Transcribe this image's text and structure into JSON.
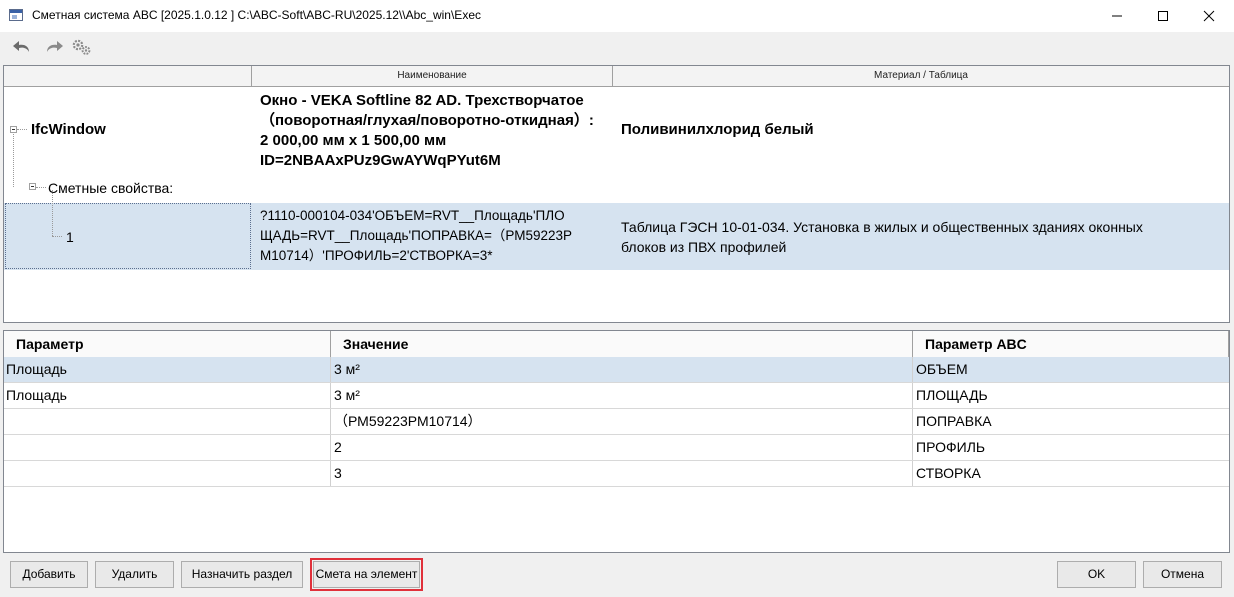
{
  "window": {
    "title": "Сметная система ABC [2025.1.0.12 ]   C:\\ABC-Soft\\ABC-RU\\2025.12\\\\Abc_win\\Exec"
  },
  "toolbar": {
    "undo_icon": "undo-arrow-icon",
    "redo_icon": "redo-arrow-icon",
    "settings_icon": "gears-icon"
  },
  "tree": {
    "columns": {
      "name": "Наименование",
      "material": "Материал / Таблица"
    },
    "root": {
      "label": "IfcWindow",
      "name_lines": [
        "Окно - VEKA Softline 82 AD. Трехстворчатое",
        "（поворотная/глухая/поворотно-откидная）:",
        "2 000,00 мм x 1 500,00 мм",
        "ID=2NBAAxPUz9GwAYWqPYut6M"
      ],
      "material": "Поливинилхлорид белый"
    },
    "group": {
      "label": "Сметные свойства:"
    },
    "item": {
      "label": "1",
      "formula_lines": [
        "?1110-000104-034'ОБЪЕМ=RVT__Площадь'ПЛО",
        "ЩАДЬ=RVT__Площадь'ПОПРАВКА=（РМ59223Р",
        "М10714）'ПРОФИЛЬ=2'СТВОРКА=3*"
      ],
      "table_lines": [
        "Таблица ГЭСН 10-01-034. Установка в жилых и общественных зданиях оконных",
        "блоков из ПВХ профилей"
      ]
    }
  },
  "grid": {
    "headers": {
      "param": "Параметр",
      "value": "Значение",
      "abc": "Параметр ABC"
    },
    "rows": [
      {
        "param": "Площадь",
        "value": "3  м²",
        "abc": "ОБЪЕМ",
        "selected": true
      },
      {
        "param": "Площадь",
        "value": "3  м²",
        "abc": "ПЛОЩАДЬ",
        "selected": false
      },
      {
        "param": "",
        "value": "（РМ59223РМ10714）",
        "abc": "ПОПРАВКА",
        "selected": false
      },
      {
        "param": "",
        "value": "2",
        "abc": "ПРОФИЛЬ",
        "selected": false
      },
      {
        "param": "",
        "value": "3",
        "abc": "СТВОРКА",
        "selected": false
      }
    ]
  },
  "buttons": {
    "add": "Добавить",
    "delete": "Удалить",
    "assign_section": "Назначить раздел",
    "estimate_element": "Смета на элемент",
    "ok": "OK",
    "cancel": "Отмена"
  },
  "colors": {
    "selection": "#d6e3f0",
    "highlight": "#e0303a"
  }
}
